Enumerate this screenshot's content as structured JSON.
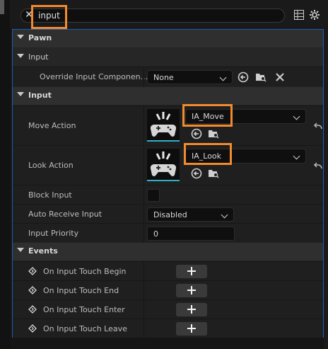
{
  "search": {
    "value": "input",
    "placeholder": ""
  },
  "toolbar": {
    "table_icon": "table-view-icon",
    "settings_icon": "gear-icon"
  },
  "sections": {
    "pawn": {
      "title": "Pawn",
      "input_sub": {
        "title": "Input",
        "override_label": "Override Input Componen...",
        "override_value": "None"
      }
    },
    "input": {
      "title": "Input",
      "move_action": {
        "label": "Move Action",
        "value": "IA_Move"
      },
      "look_action": {
        "label": "Look Action",
        "value": "IA_Look"
      },
      "block_input": {
        "label": "Block Input",
        "checked": false
      },
      "auto_receive": {
        "label": "Auto Receive Input",
        "value": "Disabled"
      },
      "input_priority": {
        "label": "Input Priority",
        "value": "0"
      }
    },
    "events": {
      "title": "Events",
      "items": [
        {
          "label": "On Input Touch Begin"
        },
        {
          "label": "On Input Touch End"
        },
        {
          "label": "On Input Touch Enter"
        },
        {
          "label": "On Input Touch Leave"
        }
      ]
    }
  },
  "colors": {
    "highlight": "#f28a2e",
    "panel_border": "#1d5fb3",
    "thumb_accent": "#2fb0c8"
  }
}
